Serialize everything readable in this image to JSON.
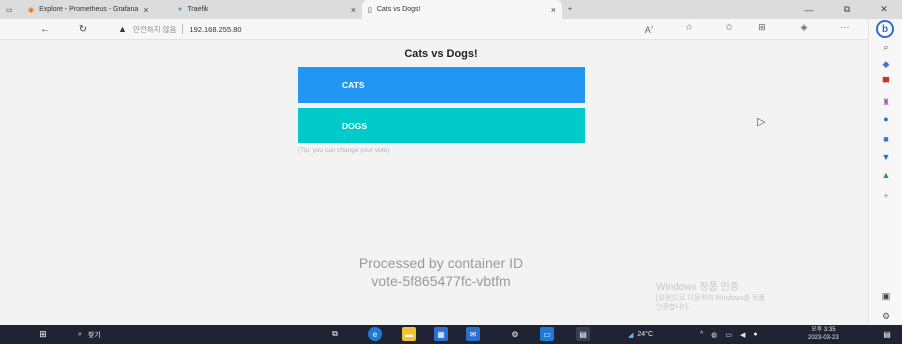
{
  "tabs": [
    {
      "label": "Explore - Prometheus - Grafana"
    },
    {
      "label": "Traefik"
    },
    {
      "label": "Cats vs Dogs!"
    }
  ],
  "address": {
    "security_text": "안전하지 않음",
    "url": "192.168.255.80"
  },
  "page": {
    "title": "Cats vs Dogs!",
    "cats_label": "CATS",
    "dogs_label": "DOGS",
    "tip": "(Tip: you can change your vote)",
    "processed_line1": "Processed by container ID",
    "processed_line2": "vote-5f865477fc-vbtfm"
  },
  "watermark": {
    "title": "Windows 정품 인증",
    "line1": "[설정]으로 이동하여 Windows를 정품",
    "line2": "인증합니다."
  },
  "taskbar": {
    "search_label": "찾기",
    "temperature": "24°C",
    "time": "오후 3:35",
    "date": "2023-03-23"
  },
  "colors": {
    "cats": "#2196f3",
    "dogs": "#00cbca",
    "taskbar": "#1f2333"
  }
}
